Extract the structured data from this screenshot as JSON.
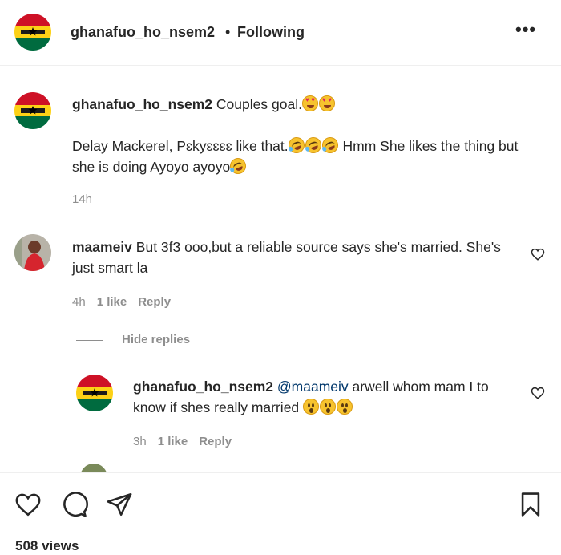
{
  "header": {
    "username": "ghanafuo_ho_nsem2",
    "separator": "•",
    "follow_status": "Following",
    "more_label": "•••"
  },
  "comments": [
    {
      "username": "ghanafuo_ho_nsem2",
      "text_line1": "Couples goal.",
      "text_para1": "Delay Mackerel, Pɛkyɛɛɛɛ like that.",
      "text_para2": " Hmm She likes the thing but she is doing Ayoyo ayoyo",
      "time": "14h"
    },
    {
      "username": "maameiv",
      "text": "But 3f3 ooo,but a reliable source says she's married. She's just smart la",
      "time": "4h",
      "likes": "1 like",
      "reply_label": "Reply"
    }
  ],
  "hide_replies_label": "Hide replies",
  "reply": {
    "username": "ghanafuo_ho_nsem2",
    "mention": "@maameiv",
    "text": " arwell whom mam I to know if shes really married ",
    "time": "3h",
    "likes": "1 like",
    "reply_label": "Reply"
  },
  "footer": {
    "views": "508 views"
  },
  "icons": [
    "more-options-icon",
    "heart-icon",
    "comment-icon",
    "share-icon",
    "bookmark-icon",
    "heart-eyes-emoji",
    "laughing-emoji",
    "astonished-emoji"
  ],
  "colors": {
    "ghana_red": "#ce1126",
    "ghana_gold": "#fcd116",
    "ghana_green": "#006b3f",
    "mention": "#00376b",
    "meta": "#8e8e8e"
  }
}
